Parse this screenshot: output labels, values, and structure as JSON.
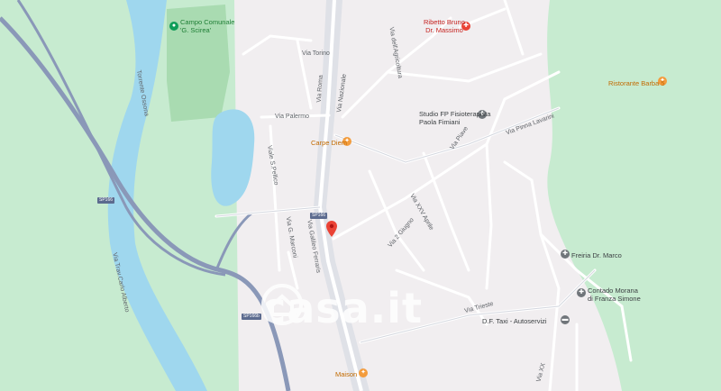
{
  "colors": {
    "land": "#f1eef0",
    "green": "#c7ebd0",
    "park": "#a9dbb1",
    "water": "#9fd7ee",
    "highway": "#8a98b8",
    "road": "#ffffff",
    "road_outline": "#d4d7df",
    "poi_red": "#ea4335",
    "poi_orange": "#f39c3d",
    "poi_gray": "#70757a"
  },
  "streets": {
    "via_nazionale": "Via Nazionale",
    "via_roma": "Via Roma",
    "via_torino": "Via Torino",
    "via_palermo": "Via Palermo",
    "viale_s_pellico": "Viale S.Pellico",
    "via_xxv_aprile": "Via XXV Aprile",
    "via_2_giugno": "Via 2 Giugno",
    "via_piave": "Via Piave",
    "via_pinna_lavarini": "Via Pinna Lavarini",
    "via_trieste": "Via Trieste",
    "via_galileo_ferraris": "Via Galileo Ferraris",
    "via_marconi": "Via G. Marconi",
    "via_trav_carlo_alberto": "Via Trav.Carlo Alberto",
    "torrente_ossona": "Torrente Ossona",
    "via_dell_agricoltura": "Via dell'Agricoltura",
    "via_xx": "Via XX"
  },
  "shields": {
    "sp_a": "SP166",
    "sp_b": "SP166",
    "sp_c": "SP166b"
  },
  "pois": {
    "campo": {
      "name": "Campo Comunale\n'G. Scirea'",
      "icon": "park-icon"
    },
    "ribetto": {
      "name": "Ribetto Bruno\nDr. Massimo",
      "icon": "medical-icon"
    },
    "ristorante": {
      "name": "Ristorante Barba 5",
      "icon": "restaurant-icon"
    },
    "studio": {
      "name": "Studio FP Fisioterapista\nPaola Fimiani",
      "icon": "health-icon"
    },
    "carpe": {
      "name": "Carpe Diem",
      "icon": "restaurant-icon"
    },
    "fresia": {
      "name": "Freiria Dr. Marco",
      "icon": "health-icon"
    },
    "contado": {
      "name": "Contado Morana\ndi Franza Simone",
      "icon": "health-icon"
    },
    "taxi": {
      "name": "D.F. Taxi - Autoservizi",
      "icon": "taxi-icon"
    },
    "maison": {
      "name": "Maison",
      "icon": "restaurant-icon"
    }
  },
  "watermark": {
    "text": "casa.it"
  }
}
